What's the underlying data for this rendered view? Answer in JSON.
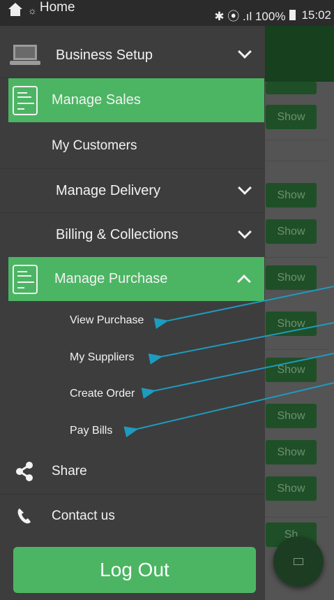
{
  "status_bar": {
    "left_label": "Home",
    "right_text": "✱ ⦿ .ıl 100%",
    "time": "15:02"
  },
  "drawer": {
    "business_setup": "Business Setup",
    "manage_sales": "Manage Sales",
    "my_customers": "My Customers",
    "manage_delivery": "Manage Delivery",
    "billing_collections": "Billing & Collections",
    "manage_purchase": "Manage Purchase",
    "submenu": [
      "View Purchase",
      "My Suppliers",
      "Create Order",
      "Pay Bills"
    ],
    "share": "Share",
    "contact_us": "Contact us",
    "logout": "Log Out"
  },
  "background_list": {
    "show_label": "Show",
    "partial_show_label": "Sh"
  },
  "colors": {
    "accent_green": "#4cb563",
    "annotation_arrow": "#1e9bbf"
  }
}
